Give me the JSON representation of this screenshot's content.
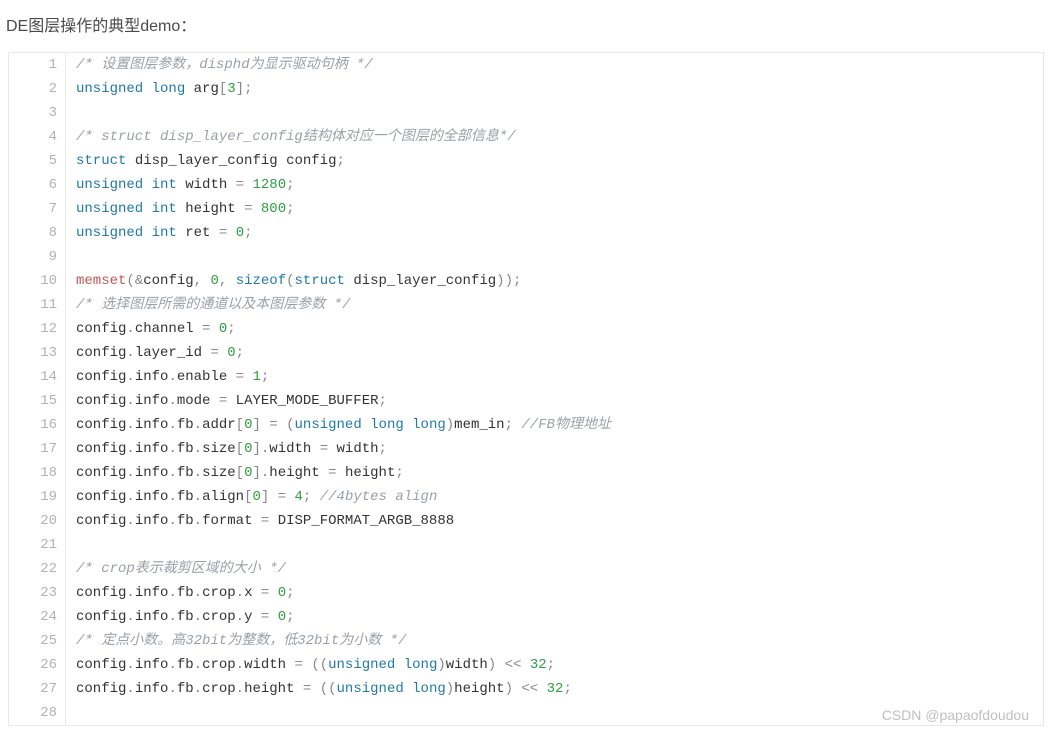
{
  "title": "DE图层操作的典型demo：",
  "watermark": "CSDN @papaofdoudou",
  "code": {
    "language": "c",
    "lines": [
      [
        {
          "t": "comment",
          "v": "/* 设置图层参数，disphd为显示驱动句柄 */"
        }
      ],
      [
        {
          "t": "keyword",
          "v": "unsigned"
        },
        {
          "t": "sp"
        },
        {
          "t": "keyword",
          "v": "long"
        },
        {
          "t": "sp"
        },
        {
          "t": "ident",
          "v": "arg"
        },
        {
          "t": "punct",
          "v": "["
        },
        {
          "t": "number",
          "v": "3"
        },
        {
          "t": "punct",
          "v": "]"
        },
        {
          "t": "punct",
          "v": ";"
        }
      ],
      [],
      [
        {
          "t": "comment",
          "v": "/* struct disp_layer_config结构体对应一个图层的全部信息*/"
        }
      ],
      [
        {
          "t": "keyword",
          "v": "struct"
        },
        {
          "t": "sp"
        },
        {
          "t": "ident",
          "v": "disp_layer_config"
        },
        {
          "t": "sp"
        },
        {
          "t": "ident",
          "v": "config"
        },
        {
          "t": "punct",
          "v": ";"
        }
      ],
      [
        {
          "t": "keyword",
          "v": "unsigned"
        },
        {
          "t": "sp"
        },
        {
          "t": "keyword",
          "v": "int"
        },
        {
          "t": "sp"
        },
        {
          "t": "ident",
          "v": "width"
        },
        {
          "t": "sp"
        },
        {
          "t": "punct",
          "v": "="
        },
        {
          "t": "sp"
        },
        {
          "t": "number",
          "v": "1280"
        },
        {
          "t": "punct",
          "v": ";"
        }
      ],
      [
        {
          "t": "keyword",
          "v": "unsigned"
        },
        {
          "t": "sp"
        },
        {
          "t": "keyword",
          "v": "int"
        },
        {
          "t": "sp"
        },
        {
          "t": "ident",
          "v": "height"
        },
        {
          "t": "sp"
        },
        {
          "t": "punct",
          "v": "="
        },
        {
          "t": "sp"
        },
        {
          "t": "number",
          "v": "800"
        },
        {
          "t": "punct",
          "v": ";"
        }
      ],
      [
        {
          "t": "keyword",
          "v": "unsigned"
        },
        {
          "t": "sp"
        },
        {
          "t": "keyword",
          "v": "int"
        },
        {
          "t": "sp"
        },
        {
          "t": "ident",
          "v": "ret"
        },
        {
          "t": "sp"
        },
        {
          "t": "punct",
          "v": "="
        },
        {
          "t": "sp"
        },
        {
          "t": "number",
          "v": "0"
        },
        {
          "t": "punct",
          "v": ";"
        }
      ],
      [],
      [
        {
          "t": "call",
          "v": "memset"
        },
        {
          "t": "punct",
          "v": "("
        },
        {
          "t": "punct",
          "v": "&"
        },
        {
          "t": "ident",
          "v": "config"
        },
        {
          "t": "punct",
          "v": ","
        },
        {
          "t": "sp"
        },
        {
          "t": "number",
          "v": "0"
        },
        {
          "t": "punct",
          "v": ","
        },
        {
          "t": "sp"
        },
        {
          "t": "keyword",
          "v": "sizeof"
        },
        {
          "t": "punct",
          "v": "("
        },
        {
          "t": "keyword",
          "v": "struct"
        },
        {
          "t": "sp"
        },
        {
          "t": "ident",
          "v": "disp_layer_config"
        },
        {
          "t": "punct",
          "v": ")"
        },
        {
          "t": "punct",
          "v": ")"
        },
        {
          "t": "punct",
          "v": ";"
        }
      ],
      [
        {
          "t": "comment",
          "v": "/* 选择图层所需的通道以及本图层参数 */"
        }
      ],
      [
        {
          "t": "ident",
          "v": "config"
        },
        {
          "t": "punct",
          "v": "."
        },
        {
          "t": "ident",
          "v": "channel"
        },
        {
          "t": "sp"
        },
        {
          "t": "punct",
          "v": "="
        },
        {
          "t": "sp"
        },
        {
          "t": "number",
          "v": "0"
        },
        {
          "t": "punct",
          "v": ";"
        }
      ],
      [
        {
          "t": "ident",
          "v": "config"
        },
        {
          "t": "punct",
          "v": "."
        },
        {
          "t": "ident",
          "v": "layer_id"
        },
        {
          "t": "sp"
        },
        {
          "t": "punct",
          "v": "="
        },
        {
          "t": "sp"
        },
        {
          "t": "number",
          "v": "0"
        },
        {
          "t": "punct",
          "v": ";"
        }
      ],
      [
        {
          "t": "ident",
          "v": "config"
        },
        {
          "t": "punct",
          "v": "."
        },
        {
          "t": "ident",
          "v": "info"
        },
        {
          "t": "punct",
          "v": "."
        },
        {
          "t": "ident",
          "v": "enable"
        },
        {
          "t": "sp"
        },
        {
          "t": "punct",
          "v": "="
        },
        {
          "t": "sp"
        },
        {
          "t": "number",
          "v": "1"
        },
        {
          "t": "punct",
          "v": ";"
        }
      ],
      [
        {
          "t": "ident",
          "v": "config"
        },
        {
          "t": "punct",
          "v": "."
        },
        {
          "t": "ident",
          "v": "info"
        },
        {
          "t": "punct",
          "v": "."
        },
        {
          "t": "ident",
          "v": "mode"
        },
        {
          "t": "sp"
        },
        {
          "t": "punct",
          "v": "="
        },
        {
          "t": "sp"
        },
        {
          "t": "ident",
          "v": "LAYER_MODE_BUFFER"
        },
        {
          "t": "punct",
          "v": ";"
        }
      ],
      [
        {
          "t": "ident",
          "v": "config"
        },
        {
          "t": "punct",
          "v": "."
        },
        {
          "t": "ident",
          "v": "info"
        },
        {
          "t": "punct",
          "v": "."
        },
        {
          "t": "ident",
          "v": "fb"
        },
        {
          "t": "punct",
          "v": "."
        },
        {
          "t": "ident",
          "v": "addr"
        },
        {
          "t": "punct",
          "v": "["
        },
        {
          "t": "number",
          "v": "0"
        },
        {
          "t": "punct",
          "v": "]"
        },
        {
          "t": "sp"
        },
        {
          "t": "punct",
          "v": "="
        },
        {
          "t": "sp"
        },
        {
          "t": "punct",
          "v": "("
        },
        {
          "t": "keyword",
          "v": "unsigned"
        },
        {
          "t": "sp"
        },
        {
          "t": "keyword",
          "v": "long"
        },
        {
          "t": "sp"
        },
        {
          "t": "keyword",
          "v": "long"
        },
        {
          "t": "punct",
          "v": ")"
        },
        {
          "t": "ident",
          "v": "mem_in"
        },
        {
          "t": "punct",
          "v": ";"
        },
        {
          "t": "sp"
        },
        {
          "t": "comment",
          "v": "//FB物理地址"
        }
      ],
      [
        {
          "t": "ident",
          "v": "config"
        },
        {
          "t": "punct",
          "v": "."
        },
        {
          "t": "ident",
          "v": "info"
        },
        {
          "t": "punct",
          "v": "."
        },
        {
          "t": "ident",
          "v": "fb"
        },
        {
          "t": "punct",
          "v": "."
        },
        {
          "t": "ident",
          "v": "size"
        },
        {
          "t": "punct",
          "v": "["
        },
        {
          "t": "number",
          "v": "0"
        },
        {
          "t": "punct",
          "v": "]"
        },
        {
          "t": "punct",
          "v": "."
        },
        {
          "t": "ident",
          "v": "width"
        },
        {
          "t": "sp"
        },
        {
          "t": "punct",
          "v": "="
        },
        {
          "t": "sp"
        },
        {
          "t": "ident",
          "v": "width"
        },
        {
          "t": "punct",
          "v": ";"
        }
      ],
      [
        {
          "t": "ident",
          "v": "config"
        },
        {
          "t": "punct",
          "v": "."
        },
        {
          "t": "ident",
          "v": "info"
        },
        {
          "t": "punct",
          "v": "."
        },
        {
          "t": "ident",
          "v": "fb"
        },
        {
          "t": "punct",
          "v": "."
        },
        {
          "t": "ident",
          "v": "size"
        },
        {
          "t": "punct",
          "v": "["
        },
        {
          "t": "number",
          "v": "0"
        },
        {
          "t": "punct",
          "v": "]"
        },
        {
          "t": "punct",
          "v": "."
        },
        {
          "t": "ident",
          "v": "height"
        },
        {
          "t": "sp"
        },
        {
          "t": "punct",
          "v": "="
        },
        {
          "t": "sp"
        },
        {
          "t": "ident",
          "v": "height"
        },
        {
          "t": "punct",
          "v": ";"
        }
      ],
      [
        {
          "t": "ident",
          "v": "config"
        },
        {
          "t": "punct",
          "v": "."
        },
        {
          "t": "ident",
          "v": "info"
        },
        {
          "t": "punct",
          "v": "."
        },
        {
          "t": "ident",
          "v": "fb"
        },
        {
          "t": "punct",
          "v": "."
        },
        {
          "t": "ident",
          "v": "align"
        },
        {
          "t": "punct",
          "v": "["
        },
        {
          "t": "number",
          "v": "0"
        },
        {
          "t": "punct",
          "v": "]"
        },
        {
          "t": "sp"
        },
        {
          "t": "punct",
          "v": "="
        },
        {
          "t": "sp"
        },
        {
          "t": "number",
          "v": "4"
        },
        {
          "t": "punct",
          "v": ";"
        },
        {
          "t": "sp"
        },
        {
          "t": "comment",
          "v": "//4bytes align"
        }
      ],
      [
        {
          "t": "ident",
          "v": "config"
        },
        {
          "t": "punct",
          "v": "."
        },
        {
          "t": "ident",
          "v": "info"
        },
        {
          "t": "punct",
          "v": "."
        },
        {
          "t": "ident",
          "v": "fb"
        },
        {
          "t": "punct",
          "v": "."
        },
        {
          "t": "ident",
          "v": "format"
        },
        {
          "t": "sp"
        },
        {
          "t": "punct",
          "v": "="
        },
        {
          "t": "sp"
        },
        {
          "t": "ident",
          "v": "DISP_FORMAT_ARGB_8888"
        }
      ],
      [],
      [
        {
          "t": "comment",
          "v": "/* crop表示裁剪区域的大小 */"
        }
      ],
      [
        {
          "t": "ident",
          "v": "config"
        },
        {
          "t": "punct",
          "v": "."
        },
        {
          "t": "ident",
          "v": "info"
        },
        {
          "t": "punct",
          "v": "."
        },
        {
          "t": "ident",
          "v": "fb"
        },
        {
          "t": "punct",
          "v": "."
        },
        {
          "t": "ident",
          "v": "crop"
        },
        {
          "t": "punct",
          "v": "."
        },
        {
          "t": "ident",
          "v": "x"
        },
        {
          "t": "sp"
        },
        {
          "t": "punct",
          "v": "="
        },
        {
          "t": "sp"
        },
        {
          "t": "number",
          "v": "0"
        },
        {
          "t": "punct",
          "v": ";"
        }
      ],
      [
        {
          "t": "ident",
          "v": "config"
        },
        {
          "t": "punct",
          "v": "."
        },
        {
          "t": "ident",
          "v": "info"
        },
        {
          "t": "punct",
          "v": "."
        },
        {
          "t": "ident",
          "v": "fb"
        },
        {
          "t": "punct",
          "v": "."
        },
        {
          "t": "ident",
          "v": "crop"
        },
        {
          "t": "punct",
          "v": "."
        },
        {
          "t": "ident",
          "v": "y"
        },
        {
          "t": "sp"
        },
        {
          "t": "punct",
          "v": "="
        },
        {
          "t": "sp"
        },
        {
          "t": "number",
          "v": "0"
        },
        {
          "t": "punct",
          "v": ";"
        }
      ],
      [
        {
          "t": "comment",
          "v": "/* 定点小数。高32bit为整数，低32bit为小数 */"
        }
      ],
      [
        {
          "t": "ident",
          "v": "config"
        },
        {
          "t": "punct",
          "v": "."
        },
        {
          "t": "ident",
          "v": "info"
        },
        {
          "t": "punct",
          "v": "."
        },
        {
          "t": "ident",
          "v": "fb"
        },
        {
          "t": "punct",
          "v": "."
        },
        {
          "t": "ident",
          "v": "crop"
        },
        {
          "t": "punct",
          "v": "."
        },
        {
          "t": "ident",
          "v": "width"
        },
        {
          "t": "sp"
        },
        {
          "t": "punct",
          "v": "="
        },
        {
          "t": "sp"
        },
        {
          "t": "punct",
          "v": "("
        },
        {
          "t": "punct",
          "v": "("
        },
        {
          "t": "keyword",
          "v": "unsigned"
        },
        {
          "t": "sp"
        },
        {
          "t": "keyword",
          "v": "long"
        },
        {
          "t": "punct",
          "v": ")"
        },
        {
          "t": "ident",
          "v": "width"
        },
        {
          "t": "punct",
          "v": ")"
        },
        {
          "t": "sp"
        },
        {
          "t": "punct",
          "v": "<<"
        },
        {
          "t": "sp"
        },
        {
          "t": "number",
          "v": "32"
        },
        {
          "t": "punct",
          "v": ";"
        }
      ],
      [
        {
          "t": "ident",
          "v": "config"
        },
        {
          "t": "punct",
          "v": "."
        },
        {
          "t": "ident",
          "v": "info"
        },
        {
          "t": "punct",
          "v": "."
        },
        {
          "t": "ident",
          "v": "fb"
        },
        {
          "t": "punct",
          "v": "."
        },
        {
          "t": "ident",
          "v": "crop"
        },
        {
          "t": "punct",
          "v": "."
        },
        {
          "t": "ident",
          "v": "height"
        },
        {
          "t": "sp"
        },
        {
          "t": "punct",
          "v": "="
        },
        {
          "t": "sp"
        },
        {
          "t": "punct",
          "v": "("
        },
        {
          "t": "punct",
          "v": "("
        },
        {
          "t": "keyword",
          "v": "unsigned"
        },
        {
          "t": "sp"
        },
        {
          "t": "keyword",
          "v": "long"
        },
        {
          "t": "punct",
          "v": ")"
        },
        {
          "t": "ident",
          "v": "height"
        },
        {
          "t": "punct",
          "v": ")"
        },
        {
          "t": "sp"
        },
        {
          "t": "punct",
          "v": "<<"
        },
        {
          "t": "sp"
        },
        {
          "t": "number",
          "v": "32"
        },
        {
          "t": "punct",
          "v": ";"
        }
      ],
      []
    ]
  }
}
